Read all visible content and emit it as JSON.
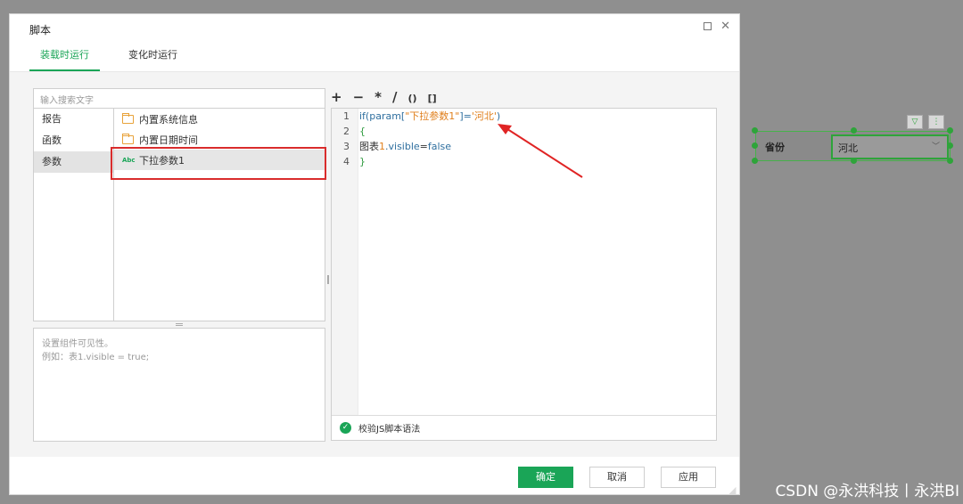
{
  "dialog": {
    "title": "脚本",
    "tabs": [
      {
        "label": "装载时运行",
        "active": true
      },
      {
        "label": "变化时运行",
        "active": false
      }
    ]
  },
  "left": {
    "search_placeholder": "输入搜索文字",
    "categories": [
      "报告",
      "函数",
      "参数"
    ],
    "selected_category": "参数",
    "items": [
      {
        "icon": "folder-icon",
        "label": "内置系统信息"
      },
      {
        "icon": "folder-icon",
        "label": "内置日期时间"
      },
      {
        "icon": "abc-param-icon",
        "icon_text": "Abc",
        "label": "下拉参数1"
      }
    ],
    "description": [
      "设置组件可见性。",
      "例如：表1.visible = true;"
    ]
  },
  "operators": [
    "+",
    "−",
    "*",
    "/",
    "()",
    "[]"
  ],
  "editor": {
    "line_numbers": [
      "1",
      "2",
      "3",
      "4"
    ],
    "line1": {
      "a": "if(param[",
      "b": "\"下拉参数1\"",
      "c": "]=",
      "d": "'河北'",
      "e": ")"
    },
    "line2": "{",
    "line3": {
      "a": "图表",
      "b": "1",
      "c": ".visible",
      "d": "=",
      "e": "false"
    },
    "line4": "}",
    "validate_label": "校验JS脚本语法"
  },
  "buttons": {
    "ok": "确定",
    "cancel": "取消",
    "apply": "应用"
  },
  "widget": {
    "label": "省份",
    "value": "河北"
  },
  "watermark": "CSDN @永洪科技丨永洪BI",
  "colors": {
    "accent": "#1aa557",
    "highlight_box": "#d92c2c",
    "code_string": "#e07f1c"
  }
}
